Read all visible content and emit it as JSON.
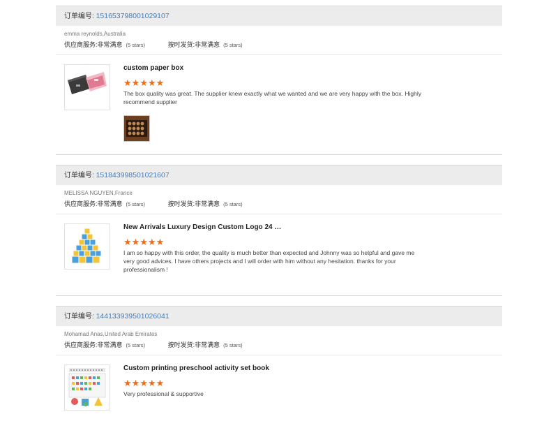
{
  "labels": {
    "order_no": "订单编号:",
    "supplier_service": "供应商服务:",
    "on_time_delivery": "按时发货:"
  },
  "colors": {
    "header_bg": "#ececec",
    "order_link": "#3f7fbf",
    "star": "#ef6c1a"
  },
  "orders": [
    {
      "order_number": "151653798001029107",
      "buyer": "emma reynolds,Australia",
      "supplier_service": {
        "value": "非常满意",
        "stars": "(5 stars)"
      },
      "on_time_delivery": {
        "value": "非常满意",
        "stars": "(5 stars)"
      },
      "product": "custom paper box",
      "rating": 5,
      "comment": "The box quality was great. The supplier knew exactly what we wanted and we are very happy with the box. Highly recommend supplier",
      "thumbnail_icon": "gift-box-image",
      "photo_icon": "chocolate-box-photo"
    },
    {
      "order_number": "151843998501021607",
      "buyer": "MELISSA NGUYEN,France",
      "supplier_service": {
        "value": "非常满意",
        "stars": "(5 stars)"
      },
      "on_time_delivery": {
        "value": "非常满意",
        "stars": "(5 stars)"
      },
      "product": "New Arrivals Luxury Design Custom Logo 24 D...",
      "rating": 5,
      "comment": "I am so happy with this order, the quality is much better than expected and Johnny was so helpful and gave me very good advices. I have others projects and I will order with him without any hesitation. thanks for your professionalism !",
      "thumbnail_icon": "advent-calendar-tower-image"
    },
    {
      "order_number": "144133939501026041",
      "buyer": "Mohamad Anas,United Arab Emirates",
      "supplier_service": {
        "value": "非常满意",
        "stars": "(5 stars)"
      },
      "on_time_delivery": {
        "value": "非常满意",
        "stars": "(5 stars)"
      },
      "product": "Custom printing preschool activity set book",
      "rating": 5,
      "comment": "Very professional & supportive",
      "thumbnail_icon": "activity-book-image"
    }
  ]
}
